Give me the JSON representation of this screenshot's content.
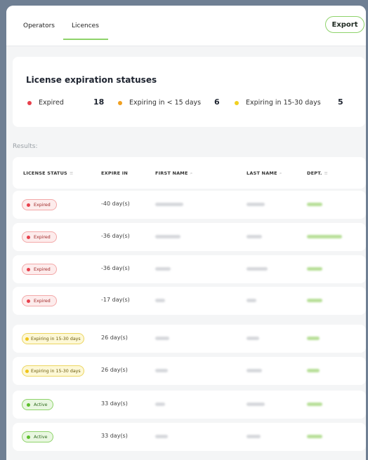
{
  "tabs": [
    "Operators",
    "Licences"
  ],
  "export_label": "Export",
  "summary": {
    "title": "License expiration statuses",
    "legend": [
      {
        "label": "Expired",
        "count": "18",
        "color": "#e8404c"
      },
      {
        "label": "Expiring in < 15 days",
        "count": "6",
        "color": "#f0a020"
      },
      {
        "label": "Expiring in 15-30 days",
        "count": "5",
        "color": "#f0d020"
      }
    ]
  },
  "results_label": "Results:",
  "columns": [
    {
      "label": "LICENSE STATUS",
      "icon": "filter-icon",
      "sym": "≡"
    },
    {
      "label": "EXPIRE IN",
      "icon": "",
      "sym": ""
    },
    {
      "label": "FIRST NAME",
      "icon": "search-icon",
      "sym": "⌕"
    },
    {
      "label": "LAST NAME",
      "icon": "search-icon",
      "sym": "⌕"
    },
    {
      "label": "DEPT.",
      "icon": "filter-icon",
      "sym": "≡"
    }
  ],
  "rows": [
    {
      "status": "Expired",
      "kind": "expired",
      "expire_in": "-40 day(s)"
    },
    {
      "status": "Expired",
      "kind": "expired",
      "expire_in": "-36 day(s)"
    },
    {
      "status": "Expired",
      "kind": "expired",
      "expire_in": "-36 day(s)"
    },
    {
      "status": "Expired",
      "kind": "expired",
      "expire_in": "-17 day(s)"
    },
    {
      "status": "Expiring in 15-30 days",
      "kind": "expiring",
      "expire_in": "26 day(s)"
    },
    {
      "status": "Expiring in 15-30 days",
      "kind": "expiring",
      "expire_in": "26 day(s)"
    },
    {
      "status": "Active",
      "kind": "active",
      "expire_in": "33 day(s)"
    },
    {
      "status": "Active",
      "kind": "active",
      "expire_in": "33 day(s)"
    }
  ]
}
